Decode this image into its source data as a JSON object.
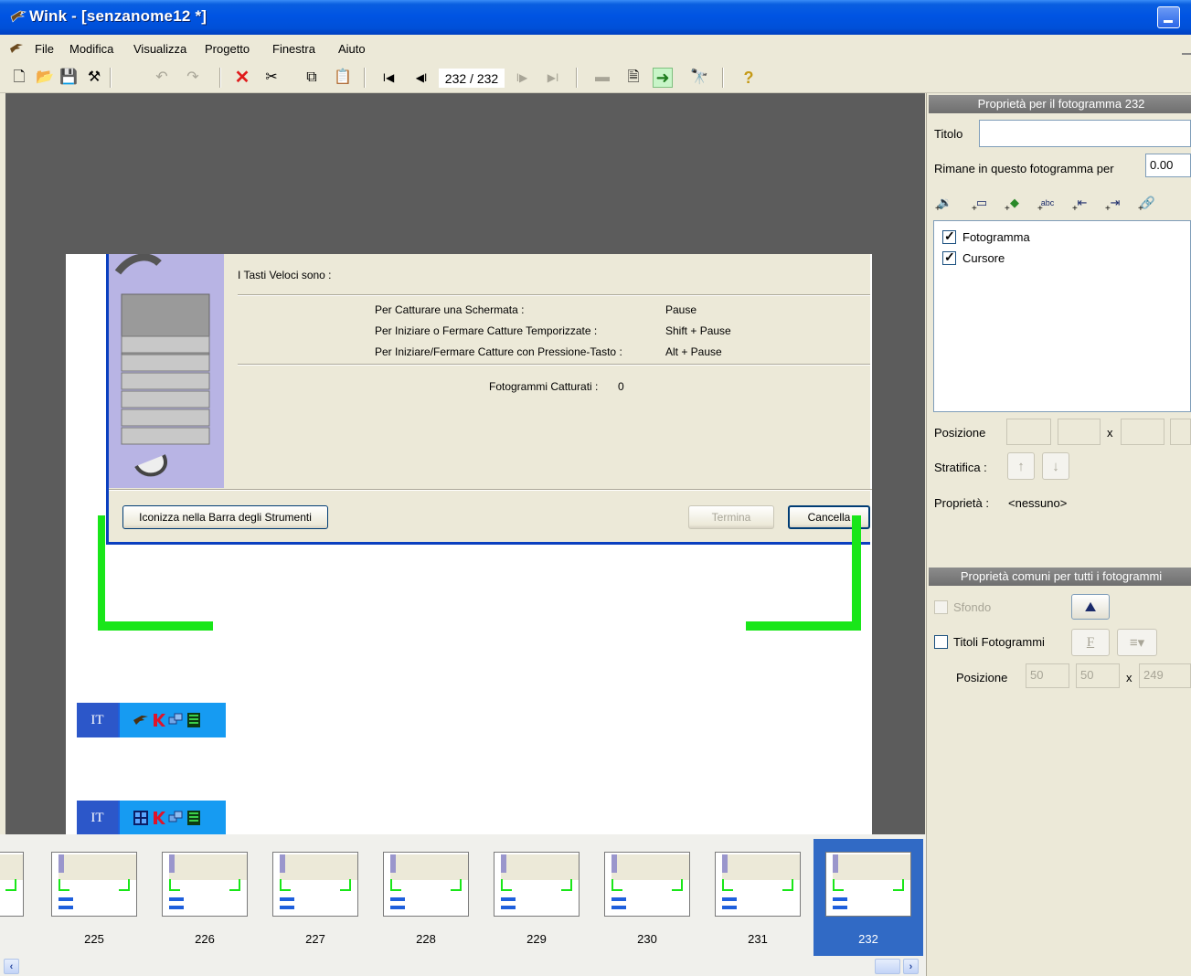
{
  "window": {
    "title": "Wink - [senzanome12 *]"
  },
  "menu": [
    "File",
    "Modifica",
    "Visualizza",
    "Progetto",
    "Finestra",
    "Aiuto"
  ],
  "toolbar": {
    "frame_counter": "232 / 232"
  },
  "capture_dialog": {
    "heading": "I Tasti Veloci sono :",
    "rows": [
      {
        "label": "Per Catturare una Schermata :",
        "value": "Pause"
      },
      {
        "label": "Per Iniziare o Fermare Catture Temporizzate :",
        "value": "Shift + Pause"
      },
      {
        "label": "Per Iniziare/Fermare Catture con Pressione-Tasto :",
        "value": "Alt + Pause"
      }
    ],
    "frames_label": "Fotogrammi Catturati :",
    "frames_value": "0",
    "minimize_button": "Iconizza nella Barra degli Strumenti",
    "finish_button": "Termina",
    "cancel_button": "Cancella"
  },
  "taskbar_lang": "IT",
  "frame_props": {
    "header": "Proprietà per il fotogramma 232",
    "title_label": "Titolo",
    "title_value": "",
    "stay_label": "Rimane in questo fotogramma per",
    "stay_value": "0.00",
    "layers": [
      {
        "label": "Fotogramma",
        "checked": true
      },
      {
        "label": "Cursore",
        "checked": true
      }
    ],
    "position_label": "Posizione",
    "position_x_sep": "x",
    "layer_label": "Stratifica :",
    "properties_label": "Proprietà :",
    "properties_value": "<nessuno>"
  },
  "common_props": {
    "header": "Proprietà comuni per tutti i fotogrammi",
    "background_label": "Sfondo",
    "titles_label": "Titoli Fotogrammi",
    "font_button": "F",
    "position_label": "Posizione",
    "pos_x": "50",
    "pos_y": "50",
    "x_sep": "x",
    "pos_w": "249"
  },
  "filmstrip": {
    "frames": [
      "225",
      "226",
      "227",
      "228",
      "229",
      "230",
      "231",
      "232"
    ],
    "selected": "232"
  }
}
